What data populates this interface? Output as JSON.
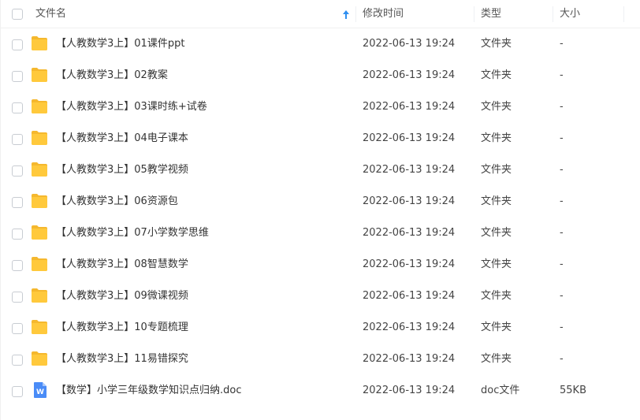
{
  "header": {
    "name_label": "文件名",
    "mtime_label": "修改时间",
    "type_label": "类型",
    "size_label": "大小",
    "sort_icon": "arrow-up-icon"
  },
  "colors": {
    "folder": "#FFC93C",
    "folder_tab": "#F5B82E",
    "doc_icon": "#4A8CF7",
    "sort_arrow": "#2F8FF0"
  },
  "files": [
    {
      "name": "【人教数学3上】01课件ppt",
      "mtime": "2022-06-13 19:24",
      "type": "文件夹",
      "size": "-",
      "icon": "folder-icon"
    },
    {
      "name": "【人教数学3上】02教案",
      "mtime": "2022-06-13 19:24",
      "type": "文件夹",
      "size": "-",
      "icon": "folder-icon"
    },
    {
      "name": "【人教数学3上】03课时练+试卷",
      "mtime": "2022-06-13 19:24",
      "type": "文件夹",
      "size": "-",
      "icon": "folder-icon"
    },
    {
      "name": "【人教数学3上】04电子课本",
      "mtime": "2022-06-13 19:24",
      "type": "文件夹",
      "size": "-",
      "icon": "folder-icon"
    },
    {
      "name": "【人教数学3上】05教学视频",
      "mtime": "2022-06-13 19:24",
      "type": "文件夹",
      "size": "-",
      "icon": "folder-icon"
    },
    {
      "name": "【人教数学3上】06资源包",
      "mtime": "2022-06-13 19:24",
      "type": "文件夹",
      "size": "-",
      "icon": "folder-icon"
    },
    {
      "name": "【人教数学3上】07小学数学思维",
      "mtime": "2022-06-13 19:24",
      "type": "文件夹",
      "size": "-",
      "icon": "folder-icon"
    },
    {
      "name": "【人教数学3上】08智慧数学",
      "mtime": "2022-06-13 19:24",
      "type": "文件夹",
      "size": "-",
      "icon": "folder-icon"
    },
    {
      "name": "【人教数学3上】09微课视频",
      "mtime": "2022-06-13 19:24",
      "type": "文件夹",
      "size": "-",
      "icon": "folder-icon"
    },
    {
      "name": "【人教数学3上】10专题梳理",
      "mtime": "2022-06-13 19:24",
      "type": "文件夹",
      "size": "-",
      "icon": "folder-icon"
    },
    {
      "name": "【人教数学3上】11易错探究",
      "mtime": "2022-06-13 19:24",
      "type": "文件夹",
      "size": "-",
      "icon": "folder-icon"
    },
    {
      "name": "【数学】小学三年级数学知识点归纳.doc",
      "mtime": "2022-06-13 19:24",
      "type": "doc文件",
      "size": "55KB",
      "icon": "word-doc-icon"
    }
  ]
}
